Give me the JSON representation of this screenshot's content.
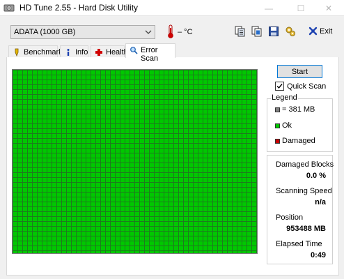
{
  "window": {
    "title": "HD Tune 2.55 - Hard Disk Utility",
    "controls": {
      "minimize": "—",
      "maximize": "☐",
      "close": "✕"
    }
  },
  "toolbar": {
    "drive": "ADATA (1000 GB)",
    "temperature": "– °C",
    "icons": [
      "copy-info-icon",
      "copy-screenshot-icon",
      "save-icon",
      "options-icon"
    ],
    "exit_label": "Exit"
  },
  "tabs": [
    {
      "label": "Benchmark",
      "icon": "benchmark-icon",
      "active": false
    },
    {
      "label": "Info",
      "icon": "info-icon",
      "active": false
    },
    {
      "label": "Health",
      "icon": "health-cross-icon",
      "active": false
    },
    {
      "label": "Error Scan",
      "icon": "magnifier-icon",
      "active": true
    }
  ],
  "error_scan": {
    "start_label": "Start",
    "quick_scan_label": "Quick Scan",
    "quick_scan_checked": true,
    "legend": {
      "title": "Legend",
      "items": [
        {
          "label": "= 381 MB",
          "color": "#808080"
        },
        {
          "label": "Ok",
          "color": "#00c800"
        },
        {
          "label": "Damaged",
          "color": "#c80000"
        }
      ]
    },
    "stats": {
      "damaged_blocks_label": "Damaged Blocks",
      "damaged_blocks_value": "0.0 %",
      "scanning_speed_label": "Scanning Speed",
      "scanning_speed_value": "n/a",
      "position_label": "Position",
      "position_value": "953488 MB",
      "elapsed_label": "Elapsed Time",
      "elapsed_value": "0:49"
    },
    "grid": {
      "status": "all blocks ok",
      "ok_color": "#00c800",
      "grid_line_color": "#1e7a1e"
    }
  }
}
